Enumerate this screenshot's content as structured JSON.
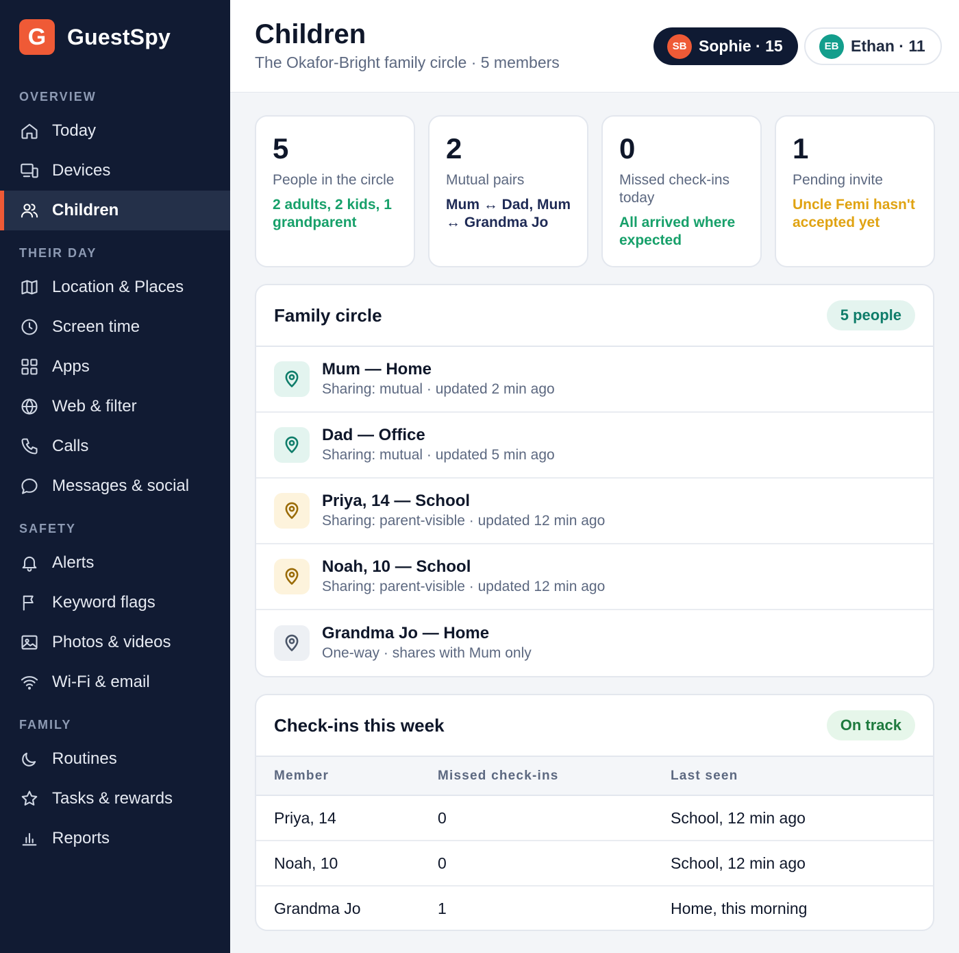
{
  "app": {
    "logo_letter": "G",
    "name": "GuestSpy"
  },
  "nav": {
    "sections": [
      {
        "title": "OVERVIEW",
        "items": [
          {
            "label": "Today",
            "icon": "home-icon"
          },
          {
            "label": "Devices",
            "icon": "devices-icon"
          },
          {
            "label": "Children",
            "icon": "users-icon",
            "active": true
          }
        ]
      },
      {
        "title": "THEIR DAY",
        "items": [
          {
            "label": "Location & Places",
            "icon": "map-icon"
          },
          {
            "label": "Screen time",
            "icon": "clock-icon"
          },
          {
            "label": "Apps",
            "icon": "apps-grid-icon"
          },
          {
            "label": "Web & filter",
            "icon": "globe-icon"
          },
          {
            "label": "Calls",
            "icon": "phone-icon"
          },
          {
            "label": "Messages & social",
            "icon": "chat-bubble-icon"
          }
        ]
      },
      {
        "title": "SAFETY",
        "items": [
          {
            "label": "Alerts",
            "icon": "bell-icon"
          },
          {
            "label": "Keyword flags",
            "icon": "flag-icon"
          },
          {
            "label": "Photos & videos",
            "icon": "image-icon"
          },
          {
            "label": "Wi-Fi & email",
            "icon": "wifi-icon"
          }
        ]
      },
      {
        "title": "FAMILY",
        "items": [
          {
            "label": "Routines",
            "icon": "moon-icon"
          },
          {
            "label": "Tasks & rewards",
            "icon": "star-icon"
          },
          {
            "label": "Reports",
            "icon": "bar-chart-icon"
          }
        ]
      }
    ]
  },
  "header": {
    "title": "Children",
    "subtitle": "The Okafor-Bright family circle · 5 members",
    "profiles": [
      {
        "initials": "SB",
        "label": "Sophie · 15",
        "selected": true
      },
      {
        "initials": "EB",
        "label": "Ethan · 11",
        "selected": false
      }
    ]
  },
  "stats": [
    {
      "value": "5",
      "label": "People in the circle",
      "note": "2 adults, 2 kids, 1 grandparent",
      "tone": "green"
    },
    {
      "value": "2",
      "label": "Mutual pairs",
      "note": "Mum ↔ Dad, Mum ↔ Grandma Jo",
      "tone": "navy"
    },
    {
      "value": "0",
      "label": "Missed check-ins today",
      "note": "All arrived where expected",
      "tone": "green"
    },
    {
      "value": "1",
      "label": "Pending invite",
      "note": "Uncle Femi hasn't accepted yet",
      "tone": "amber"
    }
  ],
  "family_circle": {
    "title": "Family circle",
    "badge": "5 people",
    "members": [
      {
        "name": "Mum — Home",
        "meta": "Sharing: mutual · updated 2 min ago",
        "tone": "teal"
      },
      {
        "name": "Dad — Office",
        "meta": "Sharing: mutual · updated 5 min ago",
        "tone": "teal"
      },
      {
        "name": "Priya, 14 — School",
        "meta": "Sharing: parent-visible · updated 12 min ago",
        "tone": "amber"
      },
      {
        "name": "Noah, 10 — School",
        "meta": "Sharing: parent-visible · updated 12 min ago",
        "tone": "amber"
      },
      {
        "name": "Grandma Jo — Home",
        "meta": "One-way · shares with Mum only",
        "tone": "gray"
      }
    ]
  },
  "checkins": {
    "title": "Check-ins this week",
    "badge": "On track",
    "columns": [
      "Member",
      "Missed check-ins",
      "Last seen"
    ],
    "rows": [
      [
        "Priya, 14",
        "0",
        "School, 12 min ago"
      ],
      [
        "Noah, 10",
        "0",
        "School, 12 min ago"
      ],
      [
        "Grandma Jo",
        "1",
        "Home, this morning"
      ]
    ]
  },
  "colors": {
    "sidebar": "#111b33",
    "accent": "#ef5a36",
    "teal": "#0f7d6a",
    "amber": "#e0a312",
    "green": "#17a06a"
  }
}
